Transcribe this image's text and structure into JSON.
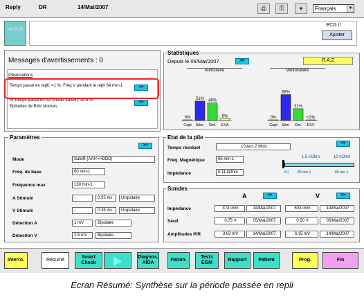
{
  "topbar": {
    "mode": "Reply",
    "status": "DR",
    "date": "14/Mai/2007",
    "language": "Français"
  },
  "ecg": {
    "left_label": "Init ECG",
    "title": "ECG II",
    "ajuster": "Ajuster"
  },
  "messages": {
    "title": "Messages d'avertissements : 0",
    "subtitle": "Observations",
    "obs1": "Temps passé en repli: <1 %. Fréq V pendant le repli 64 min-1",
    "obs2": "% Temps passé en AA (mode SafeR): 30.6 %.",
    "obs3": "Episodes de BAV stockés.",
    "go": ">>"
  },
  "stats": {
    "title": "Statistiques",
    "since": "Depuis le 05/Mai/2007",
    "go": ">>",
    "raz": "R.A.Z",
    "auricular": "Auriculaire",
    "ventricular": "Ventriculaire",
    "a_bars": [
      {
        "label": "Capt",
        "value": 0,
        "text": "0%",
        "color": "#ffffff"
      },
      {
        "label": "Stim.",
        "value": 51,
        "text": "51%",
        "color": "#2a2aee"
      },
      {
        "label": "Det.",
        "value": 46,
        "text": "46%",
        "color": "#33dd33"
      },
      {
        "label": "ESA",
        "value": 5,
        "text": "5%",
        "color": "#ffff55"
      }
    ],
    "v_bars": [
      {
        "label": "Capt",
        "value": 0,
        "text": "0%",
        "color": "#ffffff"
      },
      {
        "label": "Stim.",
        "value": 68,
        "text": "68%",
        "color": "#2a2aee"
      },
      {
        "label": "Det.",
        "value": 31,
        "text": "31%",
        "color": "#33dd33"
      },
      {
        "label": "ESV",
        "value": 1,
        "text": "<1%",
        "color": "#ffff55"
      }
    ]
  },
  "params": {
    "title": "Paramètres",
    "go": ">>",
    "mode_label": "Mode",
    "mode_val": "SafeR (AAI<=>DDD)",
    "base_label": "Fréq. de base",
    "base_val": "60 min-1",
    "max_label": "Fréquence max",
    "max_val": "130 min-1",
    "as_label": "A Stimulé",
    "as_v1": "-",
    "as_v2": "0.35 ms",
    "as_v3": "Unipolaire",
    "vs_label": "V Stimulé",
    "vs_v1": "-",
    "vs_v2": "0.35 ms",
    "vs_v3": "Unipolaire",
    "da_label": "Détection A",
    "da_v1": "1 mV",
    "da_v2": "Bipolaire",
    "dv_label": "Détection V",
    "dv_v1": "2.5 mV",
    "dv_v2": "Bipolaire"
  },
  "battery": {
    "title": "Etat de la pile",
    "go": ">>",
    "residual_label": "Temps résiduel",
    "residual_val": "10 Ans 2 Mois",
    "freq_label": "Fréq. Magnétique",
    "freq_val": "95 min-1",
    "imp_label": "Impédance",
    "imp_val": "0.11 kOhm",
    "gauge_a": "1.5 kOhm",
    "gauge_b": "10 kOhm",
    "gauge_c": "0.0",
    "gauge_d": "86 min-1",
    "gauge_e": "80 min-1",
    "gauge_level": 0.03
  },
  "leads": {
    "title": "Sondes",
    "a": "A",
    "v": "V",
    "go": ">>",
    "imp_label": "Impédance",
    "a_imp": "374 ohm",
    "a_imp_date": "14/Mai/2007",
    "v_imp": "503 ohm",
    "v_imp_date": "14/Mai/2007",
    "seuil_label": "Seuil",
    "a_seuil": "0.75 V",
    "a_seuil_date": "05/Mai/2007",
    "v_seuil": "0.50 V",
    "v_seuil_date": "05/Mai/2007",
    "amp_label": "Amplitudes P/R",
    "a_amp": "3.63 mV",
    "a_amp_date": "14/Mai/2007",
    "v_amp": "6.35 mV",
    "v_amp_date": "14/Mai/2007"
  },
  "buttons": {
    "interro": "Interro.",
    "resume": "Résumé",
    "smart": "Smart Check",
    "play": "▶",
    "diag": "Diagnos. AIDA",
    "param": "Param.",
    "tests": "Tests EGM",
    "rapport": "Rapport",
    "patient": "Patient",
    "prog": "Prog.",
    "fin": "Fin"
  },
  "caption": "Ecran Résumé: Synthèse sur la période passée en repli"
}
